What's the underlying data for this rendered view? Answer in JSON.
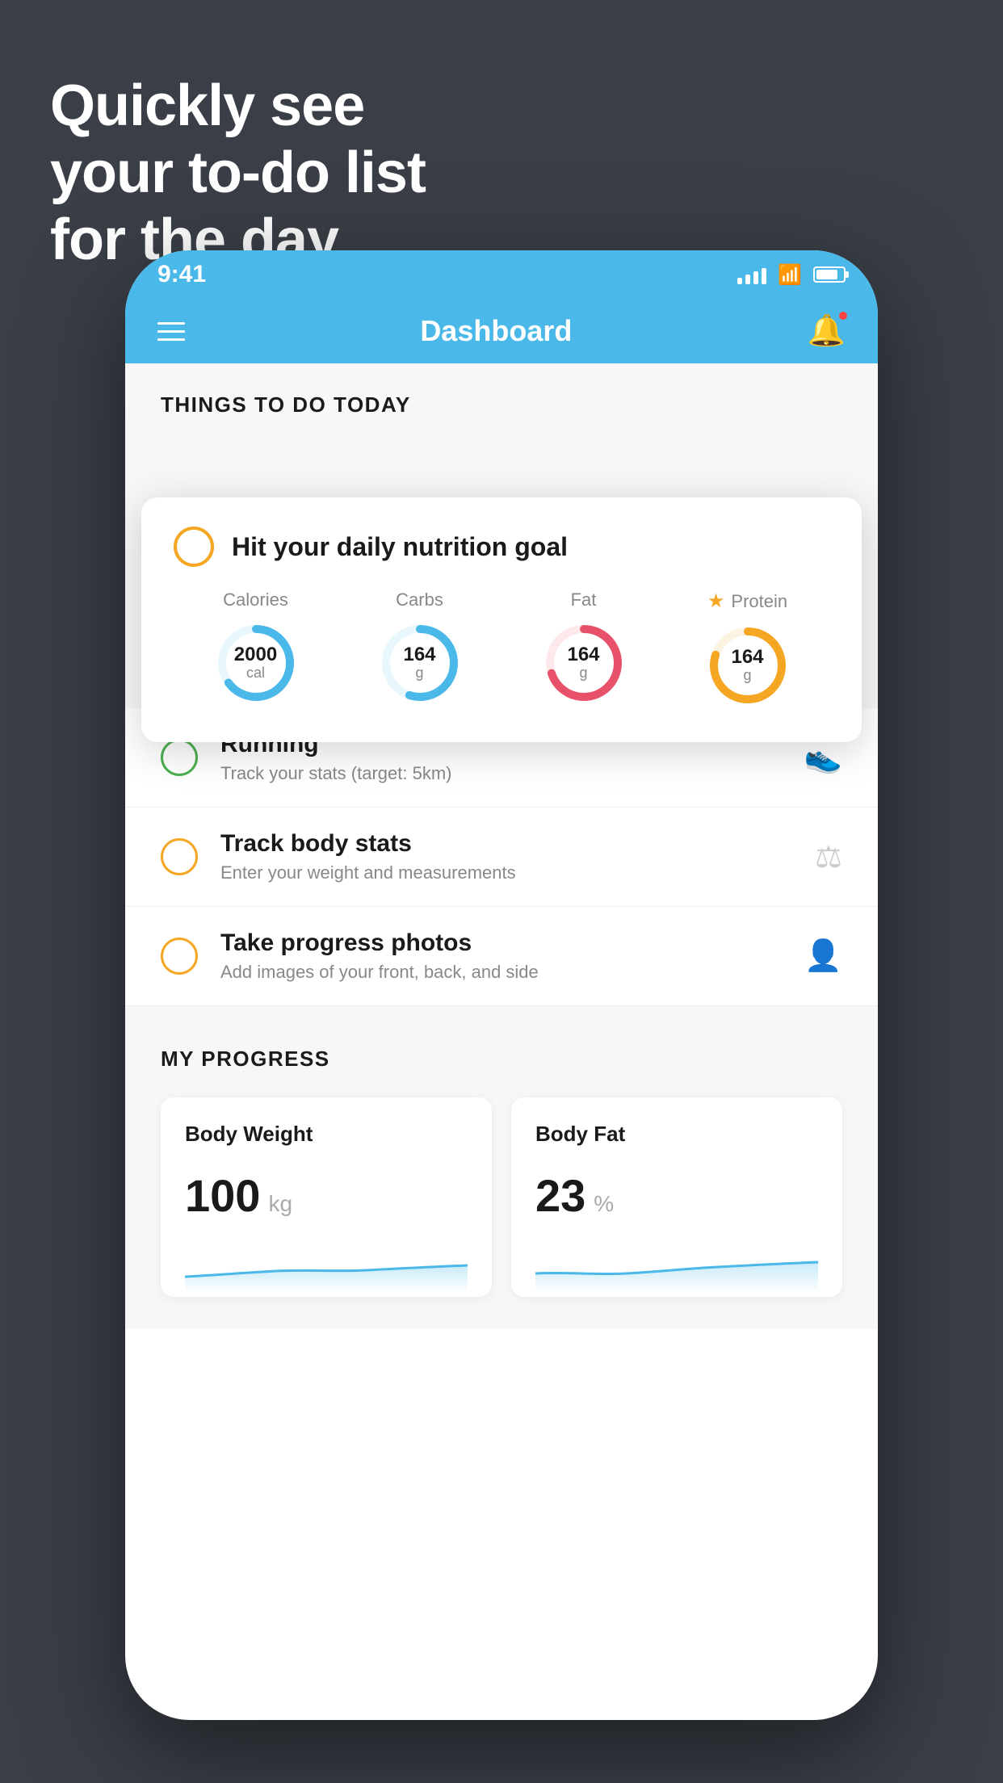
{
  "headline": {
    "line1": "Quickly see",
    "line2": "your to-do list",
    "line3": "for the day."
  },
  "status_bar": {
    "time": "9:41"
  },
  "nav": {
    "title": "Dashboard"
  },
  "things_today": {
    "section_title": "THINGS TO DO TODAY"
  },
  "nutrition_card": {
    "title": "Hit your daily nutrition goal",
    "calories": {
      "label": "Calories",
      "value": "2000",
      "unit": "cal",
      "color": "#4ab8e8",
      "percent": 65
    },
    "carbs": {
      "label": "Carbs",
      "value": "164",
      "unit": "g",
      "color": "#4ab8e8",
      "percent": 55
    },
    "fat": {
      "label": "Fat",
      "value": "164",
      "unit": "g",
      "color": "#e8516a",
      "percent": 70
    },
    "protein": {
      "label": "Protein",
      "value": "164",
      "unit": "g",
      "color": "#f5a623",
      "percent": 80,
      "starred": true
    }
  },
  "tasks": [
    {
      "name": "Running",
      "desc": "Track your stats (target: 5km)",
      "check_color": "green",
      "icon": "shoe"
    },
    {
      "name": "Track body stats",
      "desc": "Enter your weight and measurements",
      "check_color": "yellow",
      "icon": "scale"
    },
    {
      "name": "Take progress photos",
      "desc": "Add images of your front, back, and side",
      "check_color": "yellow",
      "icon": "person"
    }
  ],
  "progress": {
    "section_title": "MY PROGRESS",
    "body_weight": {
      "title": "Body Weight",
      "value": "100",
      "unit": "kg"
    },
    "body_fat": {
      "title": "Body Fat",
      "value": "23",
      "unit": "%"
    }
  }
}
